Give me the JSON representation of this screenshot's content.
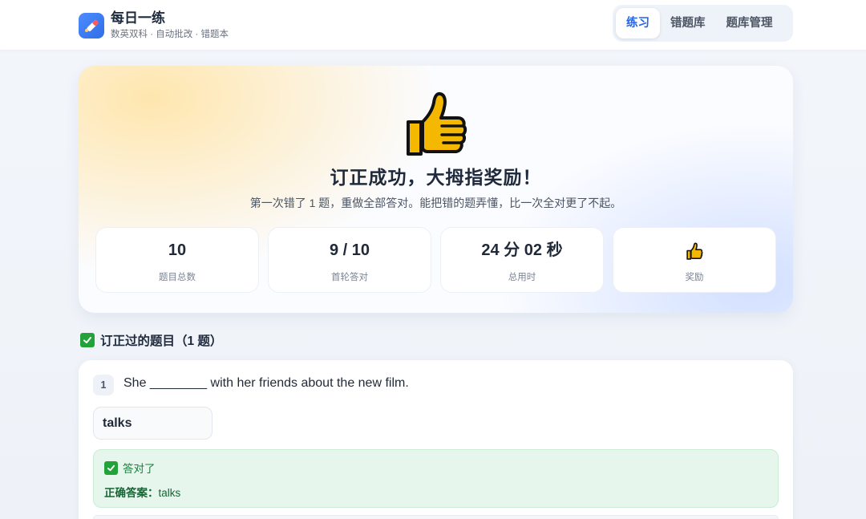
{
  "app": {
    "title": "每日一练",
    "subtitle": "数英双科 · 自动批改 · 错题本"
  },
  "nav": {
    "tabs": [
      {
        "label": "练习",
        "active": true
      },
      {
        "label": "错题库",
        "active": false
      },
      {
        "label": "题库管理",
        "active": false
      }
    ]
  },
  "hero": {
    "icon": "thumbs-up-icon",
    "title": "订正成功，大拇指奖励！",
    "description": "第一次错了 1 题，重做全部答对。能把错的题弄懂，比一次全对更了不起。",
    "stats": [
      {
        "value": "10",
        "label": "题目总数"
      },
      {
        "value": "9 / 10",
        "label": "首轮答对"
      },
      {
        "value": "24 分 02 秒",
        "label": "总用时"
      },
      {
        "value": "",
        "icon": "thumbs-up-icon",
        "label": "奖励"
      }
    ]
  },
  "section": {
    "icon": "check-mark-icon",
    "title": "订正过的题目（1 题）"
  },
  "questions": [
    {
      "number": "1",
      "text": "She ________ with her friends about the new film.",
      "user_answer": "talks",
      "result_label": "答对了",
      "correct_label": "正确答案：",
      "correct_answer": "talks"
    }
  ],
  "colors": {
    "accent": "#2563eb",
    "success": "#22a33a",
    "thumb": "#f5b800"
  }
}
